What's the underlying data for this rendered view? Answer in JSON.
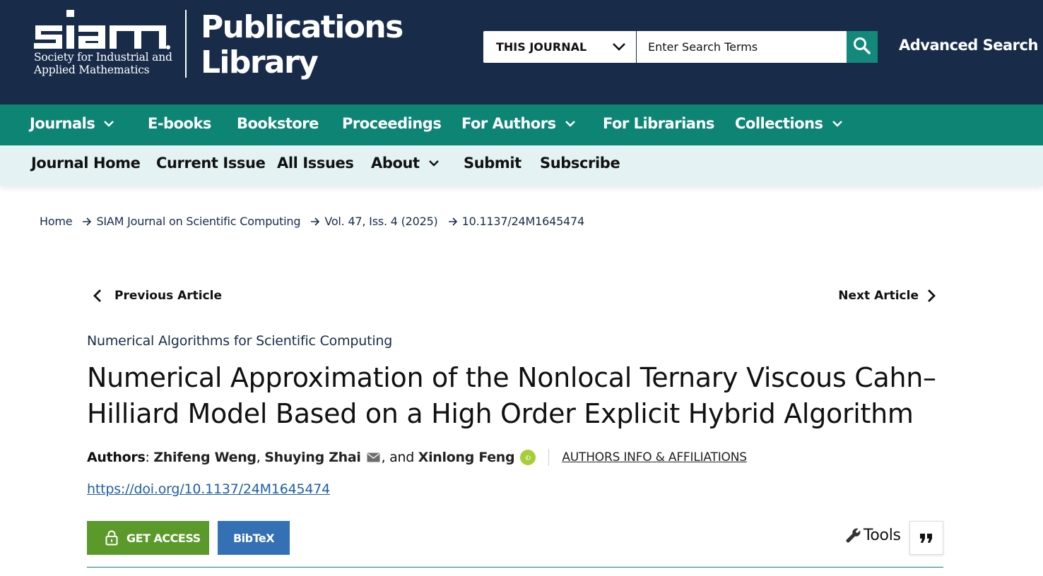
{
  "header": {
    "logo_wordmark": "siam",
    "logo_sub_line1": "Society for Industrial and",
    "logo_sub_line2": "Applied Mathematics",
    "library_title_line1": "Publications",
    "library_title_line2": "Library",
    "search_scope": "THIS JOURNAL",
    "search_placeholder": "Enter Search Terms",
    "advanced_search": "Advanced Search"
  },
  "main_nav": [
    {
      "label": "Journals",
      "dropdown": true
    },
    {
      "label": "E-books",
      "dropdown": false
    },
    {
      "label": "Bookstore",
      "dropdown": false
    },
    {
      "label": "Proceedings",
      "dropdown": false
    },
    {
      "label": "For Authors",
      "dropdown": true
    },
    {
      "label": "For Librarians",
      "dropdown": false
    },
    {
      "label": "Collections",
      "dropdown": true
    }
  ],
  "sub_nav": [
    {
      "label": "Journal Home",
      "dropdown": false
    },
    {
      "label": "Current Issue",
      "dropdown": false
    },
    {
      "label": "All Issues",
      "dropdown": false
    },
    {
      "label": "About",
      "dropdown": true
    },
    {
      "label": "Submit",
      "dropdown": false
    },
    {
      "label": "Subscribe",
      "dropdown": false
    }
  ],
  "breadcrumb": [
    "Home",
    "SIAM Journal on Scientific Computing",
    "Vol. 47, Iss. 4 (2025)",
    "10.1137/24M1645474"
  ],
  "article_nav": {
    "previous": "Previous Article",
    "next": "Next Article"
  },
  "article": {
    "section": "Numerical Algorithms for Scientific Computing",
    "title": "Numerical Approximation of the Nonlocal Ternary Viscous Cahn–Hilliard Model Based on a High Order Explicit Hybrid Algorithm",
    "authors_label": "Authors",
    "authors": [
      "Zhifeng Weng",
      "Shuying Zhai",
      "Xinlong Feng"
    ],
    "author_sep1": ", ",
    "author_sep2": ", and ",
    "affiliations_link": "AUTHORS INFO & AFFILIATIONS",
    "doi_url": "https://doi.org/10.1137/24M1645474"
  },
  "actions": {
    "get_access": "GET ACCESS",
    "bibtex": "BibTeX",
    "tools": "Tools"
  },
  "colors": {
    "header_bg": "#182c4a",
    "main_nav_bg": "#0e8574",
    "sub_nav_bg": "#e4f2f3",
    "search_button": "#12897a",
    "get_access": "#5b9a2a",
    "bibtex": "#3370b4",
    "link": "#1f5fa8",
    "orcid": "#a6ce39"
  },
  "icons": {
    "search": "magnifier-icon",
    "dropdown": "chevron-down-icon",
    "breadcrumb_separator": "arrow-right-icon",
    "previous": "chevron-left-icon",
    "next": "chevron-right-icon",
    "email": "envelope-icon",
    "orcid": "orcid-icon",
    "lock": "lock-icon",
    "tools": "wrench-icon",
    "cite": "quote-icon"
  }
}
